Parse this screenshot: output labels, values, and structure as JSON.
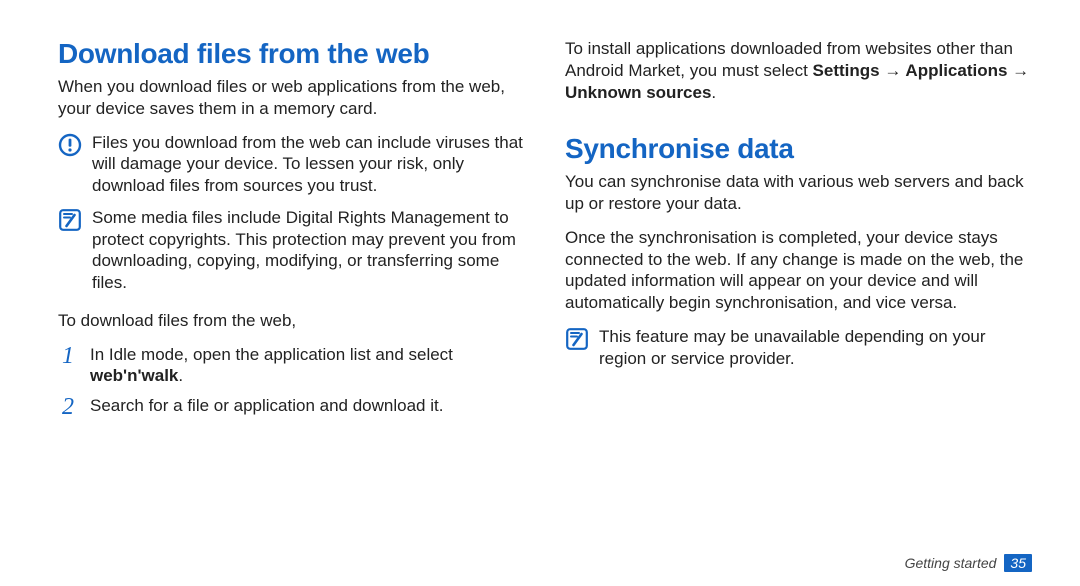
{
  "left": {
    "heading": "Download files from the web",
    "intro": "When you download files or web applications from the web, your device saves them in a memory card.",
    "warn": "Files you download from the web can include viruses that will damage your device. To lessen your risk, only download files from sources you trust.",
    "note": "Some media files include Digital Rights Management to protect copyrights. This protection may prevent you from downloading, copying, modifying, or transferring some files.",
    "howto_lead": "To download files from the web,",
    "step1_pre": "In Idle mode, open the application list and select ",
    "step1_bold": "web'n'walk",
    "step1_post": ".",
    "step2": "Search for a file or application and download it."
  },
  "right": {
    "install_pre": "To install applications downloaded from websites other than Android Market, you must select ",
    "install_bold": "Settings → Applications → Unknown sources",
    "install_post": ".",
    "heading": "Synchronise data",
    "p1": "You can synchronise data with various web servers and back up or restore your data.",
    "p2": "Once the synchronisation is completed, your device stays connected to the web. If any change is made on the web, the updated information will appear on your device and will automatically begin synchronisation, and vice versa.",
    "note": "This feature may be unavailable depending on your region or service provider."
  },
  "footer": {
    "section": "Getting started",
    "page": "35"
  },
  "nums": {
    "one": "1",
    "two": "2"
  }
}
